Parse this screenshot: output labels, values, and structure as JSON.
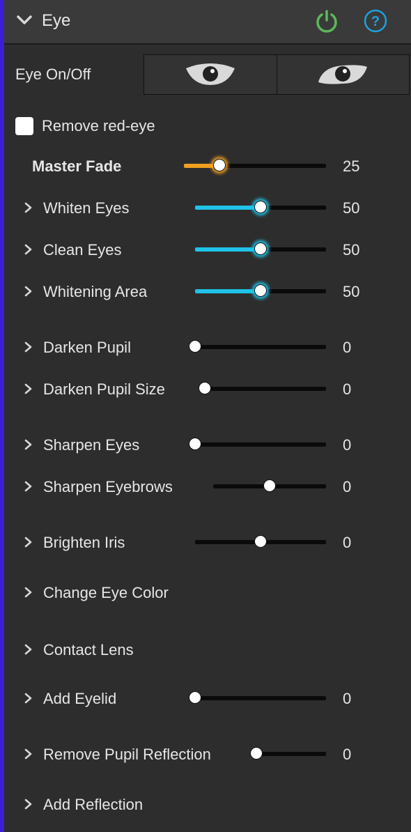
{
  "header": {
    "title": "Eye",
    "power_icon": "power-icon",
    "help_icon": "help-icon",
    "power_color": "#5cb85c",
    "help_color": "#1ea0e0"
  },
  "eye_toggle": {
    "label": "Eye On/Off",
    "options": [
      "eye-open-icon",
      "eye-narrow-icon"
    ]
  },
  "remove_red_eye": {
    "label": "Remove red-eye",
    "checked": false
  },
  "accent_colors": {
    "master": "#f0a020",
    "highlight": "#1fc3e8",
    "sidebar": "#3a1fd6"
  },
  "sliders": [
    {
      "id": "master-fade",
      "label": "Master Fade",
      "value": "25",
      "level": 0.25,
      "style": "master"
    },
    {
      "id": "whiten-eyes",
      "label": "Whiten Eyes",
      "value": "50",
      "level": 0.5,
      "style": "highlight"
    },
    {
      "id": "clean-eyes",
      "label": "Clean Eyes",
      "value": "50",
      "level": 0.5,
      "style": "highlight"
    },
    {
      "id": "whitening-area",
      "label": "Whitening Area",
      "value": "50",
      "level": 0.5,
      "style": "highlight"
    },
    {
      "id": "darken-pupil",
      "label": "Darken Pupil",
      "value": "0",
      "level": 0,
      "style": "plain"
    },
    {
      "id": "darken-pupil-size",
      "label": "Darken Pupil Size",
      "value": "0",
      "level": 0,
      "style": "plain"
    },
    {
      "id": "sharpen-eyes",
      "label": "Sharpen Eyes",
      "value": "0",
      "level": 0,
      "style": "plain"
    },
    {
      "id": "sharpen-eyebrows",
      "label": "Sharpen Eyebrows",
      "value": "0",
      "level": 0.5,
      "style": "plain"
    },
    {
      "id": "brighten-iris",
      "label": "Brighten Iris",
      "value": "0",
      "level": 0.5,
      "style": "plain"
    },
    {
      "id": "change-eye-color",
      "label": "Change Eye Color"
    },
    {
      "id": "contact-lens",
      "label": "Contact Lens"
    },
    {
      "id": "add-eyelid",
      "label": "Add Eyelid",
      "value": "0",
      "level": 0,
      "style": "plain"
    },
    {
      "id": "remove-pupil-reflection",
      "label": "Remove Pupil Reflection",
      "value": "0",
      "level": 0,
      "style": "plain"
    },
    {
      "id": "add-reflection",
      "label": "Add Reflection"
    }
  ]
}
